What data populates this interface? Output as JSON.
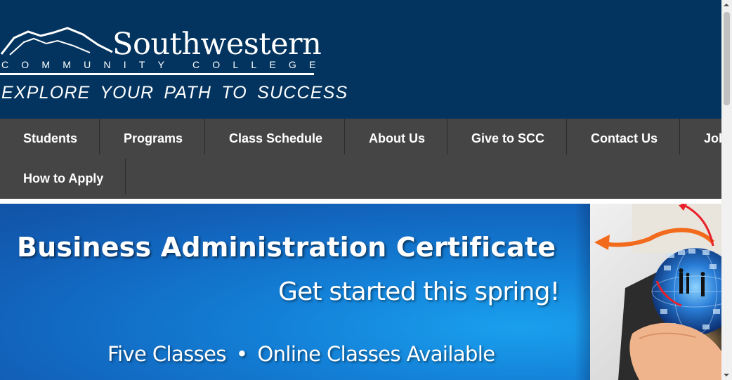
{
  "header": {
    "logo_name": "Southwestern",
    "logo_sub": "COMMUNITY COLLEGE",
    "tagline": "EXPLORE YOUR PATH TO SUCCESS",
    "background": "#03345f"
  },
  "nav": {
    "background": "#454545",
    "items": [
      {
        "label": "Students"
      },
      {
        "label": "Programs"
      },
      {
        "label": "Class Schedule"
      },
      {
        "label": "About Us"
      },
      {
        "label": "Give to SCC"
      },
      {
        "label": "Contact Us"
      },
      {
        "label": "Jobs"
      },
      {
        "label": "How to Apply"
      }
    ]
  },
  "banner": {
    "title": "Business Administration Certificate",
    "subtitle": "Get started this spring!",
    "bottom_left": "Five Classes",
    "bottom_sep": "•",
    "bottom_right": "Online Classes Available",
    "background": "#137fd6",
    "arrow_color": "#f26a1b"
  }
}
